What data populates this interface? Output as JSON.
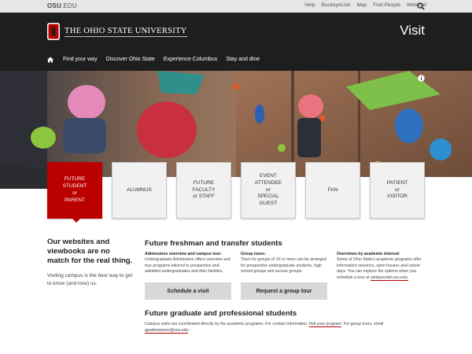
{
  "topbar": {
    "site_prefix": "OSU",
    "site_suffix": ".EDU",
    "links": [
      "Help",
      "BuckeyeLink",
      "Map",
      "Find People",
      "Webmail"
    ],
    "search_icon": "search-icon"
  },
  "masthead": {
    "logo_icon": "block-o-logo",
    "university": "THE OHIO STATE UNIVERSITY",
    "page_heading": "Visit",
    "accent_color": "#bb0000"
  },
  "nav": {
    "home_icon": "home-icon",
    "items": [
      "Find your way",
      "Discover Ohio State",
      "Experience Columbus",
      "Stay and dine"
    ]
  },
  "hero": {
    "info_icon": "info-icon"
  },
  "tiles": [
    {
      "lines": [
        "FUTURE",
        "STUDENT",
        "or",
        "PARENT"
      ],
      "active": true
    },
    {
      "lines": [
        "ALUMNUS"
      ],
      "active": false
    },
    {
      "lines": [
        "FUTURE",
        "FACULTY",
        "or STAFF"
      ],
      "active": false
    },
    {
      "lines": [
        "EVENT",
        "ATTENDEE",
        "or",
        "SPECIAL",
        "GUEST"
      ],
      "active": false
    },
    {
      "lines": [
        "FAN"
      ],
      "active": false
    },
    {
      "lines": [
        "PATIENT",
        "or",
        "VISITOR"
      ],
      "active": false
    }
  ],
  "intro": {
    "title": "Our websites and viewbooks are no match for the real thing.",
    "body": "Visiting campus is the best way to get to know (and love) us."
  },
  "freshman": {
    "title": "Future freshman and transfer students",
    "col1": {
      "heading": "Admissions overview and campus tour:",
      "body": "Undergraduate Admissions offers overview and tour programs tailored to prospective and admitted undergraduates and their families."
    },
    "col2": {
      "heading": "Group tours:",
      "body": "Tours for groups of 10 or more can be arranged for prospective undergraduate students, high school groups and access groups."
    },
    "col3": {
      "heading": "Overviews by academic interest:",
      "body": "Some of Ohio State's academic programs offer information sessions, open houses and career days. You can explore the options when you schedule a tour at",
      "link": "campusvisit.osu.edu."
    },
    "btn_visit": "Schedule a visit",
    "btn_group": "Request a group tour"
  },
  "graduate": {
    "title": "Future graduate and professional students",
    "text_a": "Campus visits are coordinated directly by the academic programs. For contact information,",
    "link_program": "find your program",
    "text_b": ". For group tours, email",
    "link_email": "gpadmissions@osu.edu",
    "text_c": "."
  }
}
